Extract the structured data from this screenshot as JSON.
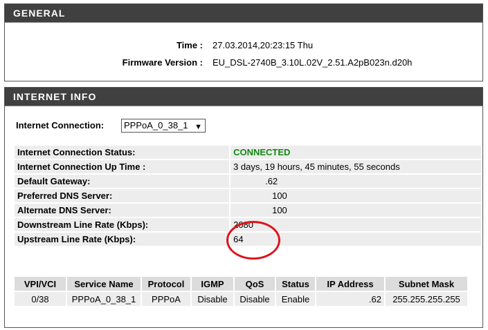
{
  "general": {
    "header": "GENERAL",
    "time_label": "Time :",
    "time_value": "27.03.2014,20:23:15 Thu",
    "firmware_label": "Firmware Version :",
    "firmware_value": "EU_DSL-2740B_3.10L.02V_2.51.A2pB023n.d20h"
  },
  "internet": {
    "header": "INTERNET INFO",
    "connection_label": "Internet Connection:",
    "connection_selected": "PPPoA_0_38_1",
    "status_color": "#118811",
    "rows": [
      {
        "label": "Internet Connection Status:",
        "value": "CONNECTED"
      },
      {
        "label": "Internet Connection Up Time :",
        "value": "3 days, 19 hours, 45 minutes, 55 seconds"
      },
      {
        "label": "Default Gateway:",
        "value": ".62"
      },
      {
        "label": "Preferred DNS Server:",
        "value": "100"
      },
      {
        "label": "Alternate DNS Server:",
        "value": "100"
      },
      {
        "label": "Downstream Line Rate (Kbps):",
        "value": "2080"
      },
      {
        "label": "Upstream Line Rate (Kbps):",
        "value": "64"
      }
    ],
    "vc_table": {
      "headers": [
        "VPI/VCI",
        "Service Name",
        "Protocol",
        "IGMP",
        "QoS",
        "Status",
        "IP Address",
        "Subnet Mask"
      ],
      "row": [
        "0/38",
        "PPPoA_0_38_1",
        "PPPoA",
        "Disable",
        "Disable",
        "Enable",
        ".62",
        "255.255.255.255"
      ]
    }
  },
  "annotation_color": "#e0121a"
}
